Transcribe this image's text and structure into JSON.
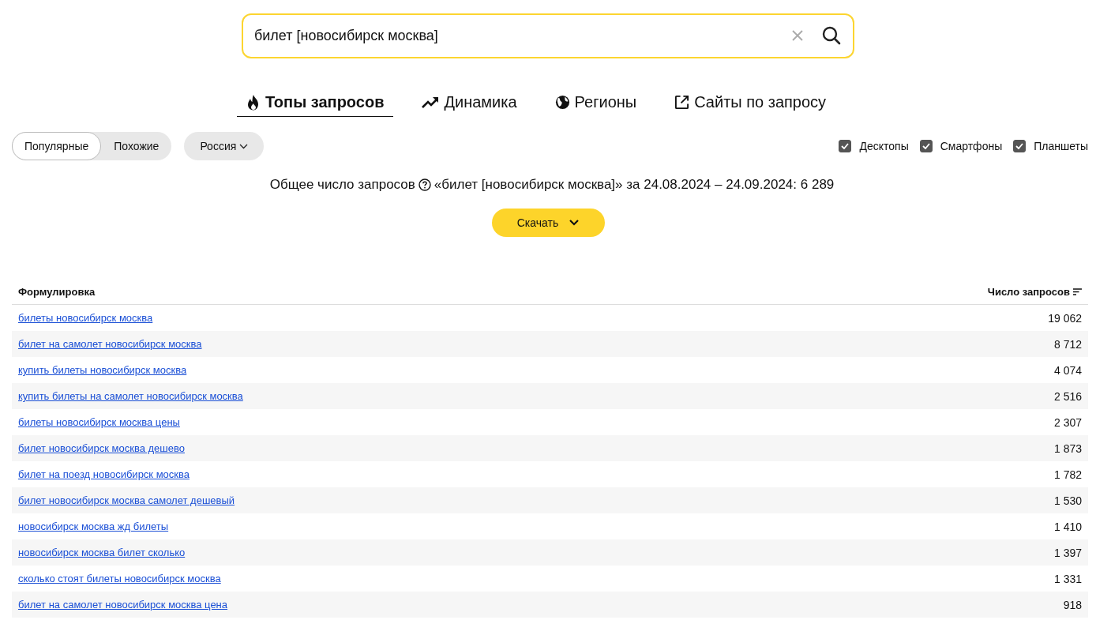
{
  "search": {
    "value": "билет [новосибирск москва]"
  },
  "tabs": [
    {
      "label": "Топы запросов",
      "kind": "fire",
      "selected": true
    },
    {
      "label": "Динамика",
      "kind": "trend",
      "selected": false
    },
    {
      "label": "Регионы",
      "kind": "globe",
      "selected": false
    },
    {
      "label": "Сайты по запросу",
      "kind": "external",
      "selected": false
    }
  ],
  "mode_switch": [
    {
      "label": "Популярные",
      "selected": true
    },
    {
      "label": "Похожие",
      "selected": false
    }
  ],
  "region": {
    "label": "Россия"
  },
  "devices": [
    {
      "label": "Десктопы",
      "checked": true
    },
    {
      "label": "Смартфоны",
      "checked": true
    },
    {
      "label": "Планшеты",
      "checked": true
    }
  ],
  "summary": {
    "label": "Общее число запросов",
    "text": "«билет [новосибирск москва]» за 24.08.2024 – 24.09.2024: 6 289"
  },
  "download_button": {
    "label": "Скачать"
  },
  "table": {
    "columns": [
      "Формулировка",
      "Число запросов"
    ],
    "rows": [
      {
        "query": "билеты новосибирск москва",
        "count": "19 062"
      },
      {
        "query": "билет на самолет новосибирск москва",
        "count": "8 712"
      },
      {
        "query": "купить билеты новосибирск москва",
        "count": "4 074"
      },
      {
        "query": "купить билеты на самолет новосибирск москва",
        "count": "2 516"
      },
      {
        "query": "билеты новосибирск москва цены",
        "count": "2 307"
      },
      {
        "query": "билет новосибирск москва дешево",
        "count": "1 873"
      },
      {
        "query": "билет на поезд новосибирск москва",
        "count": "1 782"
      },
      {
        "query": "билет новосибирск москва самолет дешевый",
        "count": "1 530"
      },
      {
        "query": "новосибирск москва жд билеты",
        "count": "1 410"
      },
      {
        "query": "новосибирск москва билет сколько",
        "count": "1 397"
      },
      {
        "query": "сколько стоят билеты новосибирск москва",
        "count": "1 331"
      },
      {
        "query": "билет на самолет новосибирск москва цена",
        "count": "918"
      }
    ]
  }
}
